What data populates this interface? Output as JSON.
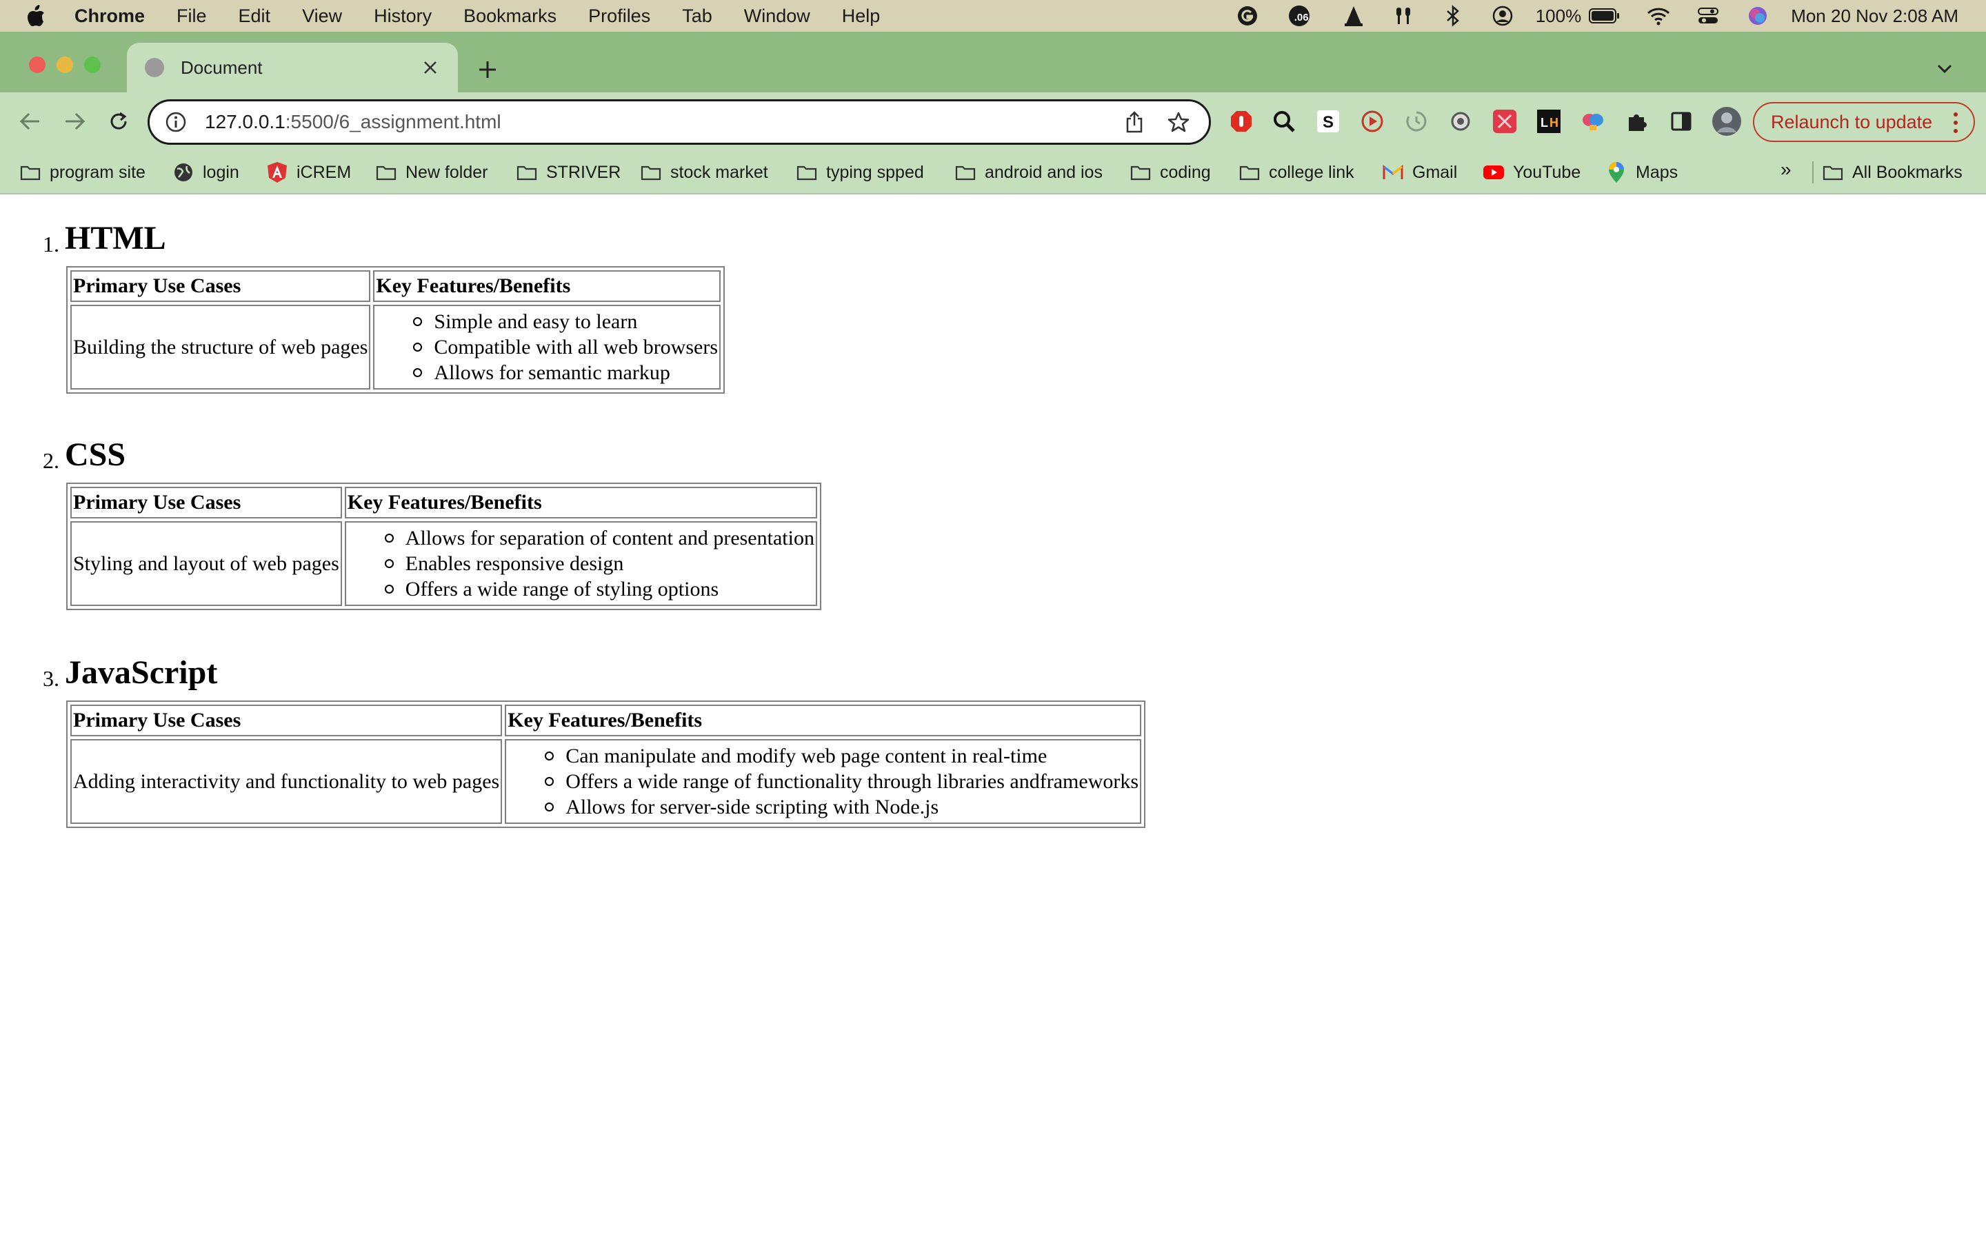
{
  "menubar": {
    "app": "Chrome",
    "items": [
      "File",
      "Edit",
      "View",
      "History",
      "Bookmarks",
      "Profiles",
      "Tab",
      "Window",
      "Help"
    ],
    "battery": "100%",
    "datetime": "Mon 20 Nov  2:08 AM",
    "badge": ".06"
  },
  "tab": {
    "title": "Document"
  },
  "toolbar": {
    "url_host": "127.0.0.1",
    "url_path": ":5500/6_assignment.html",
    "relaunch_label": "Relaunch to update"
  },
  "bookmarks": {
    "items": [
      {
        "label": "program site",
        "icon": "folder-icon"
      },
      {
        "label": "login",
        "icon": "globe-icon"
      },
      {
        "label": "iCREM",
        "icon": "angular-icon"
      },
      {
        "label": "New folder",
        "icon": "folder-icon"
      },
      {
        "label": "STRIVER",
        "icon": "folder-icon"
      },
      {
        "label": "stock market",
        "icon": "folder-icon"
      },
      {
        "label": "typing spped",
        "icon": "folder-icon"
      },
      {
        "label": "android and ios",
        "icon": "folder-icon"
      },
      {
        "label": "coding",
        "icon": "folder-icon"
      },
      {
        "label": "college link",
        "icon": "folder-icon"
      },
      {
        "label": "Gmail",
        "icon": "gmail-icon"
      },
      {
        "label": "YouTube",
        "icon": "youtube-icon"
      },
      {
        "label": "Maps",
        "icon": "maps-icon"
      }
    ],
    "more": "»",
    "all": "All Bookmarks"
  },
  "content": {
    "sections": [
      {
        "number": "1.",
        "title": "HTML",
        "header_use": "Primary Use Cases",
        "header_features": "Key Features/Benefits",
        "use_case": "Building the structure of web pages",
        "features": [
          "Simple and easy to learn",
          "Compatible with all web browsers",
          "Allows for semantic markup"
        ]
      },
      {
        "number": "2.",
        "title": "CSS",
        "header_use": "Primary Use Cases",
        "header_features": "Key Features/Benefits",
        "use_case": "Styling and layout of web pages",
        "features": [
          "Allows for separation of content and presentation",
          "Enables responsive design",
          "Offers a wide range of styling options"
        ]
      },
      {
        "number": "3.",
        "title": "JavaScript",
        "header_use": "Primary Use Cases",
        "header_features": "Key Features/Benefits",
        "use_case": "Adding interactivity and functionality to web pages",
        "features": [
          "Can manipulate and modify web page content in real-time",
          "Offers a wide range of functionality through libraries andframeworks",
          "Allows for server-side scripting with Node.js"
        ]
      }
    ]
  },
  "colors": {
    "menubar_bg": "#d8d2b4",
    "tabstrip_bg": "#8fba82",
    "toolbar_bg": "#c5dfbd",
    "relaunch": "#b3261e"
  }
}
